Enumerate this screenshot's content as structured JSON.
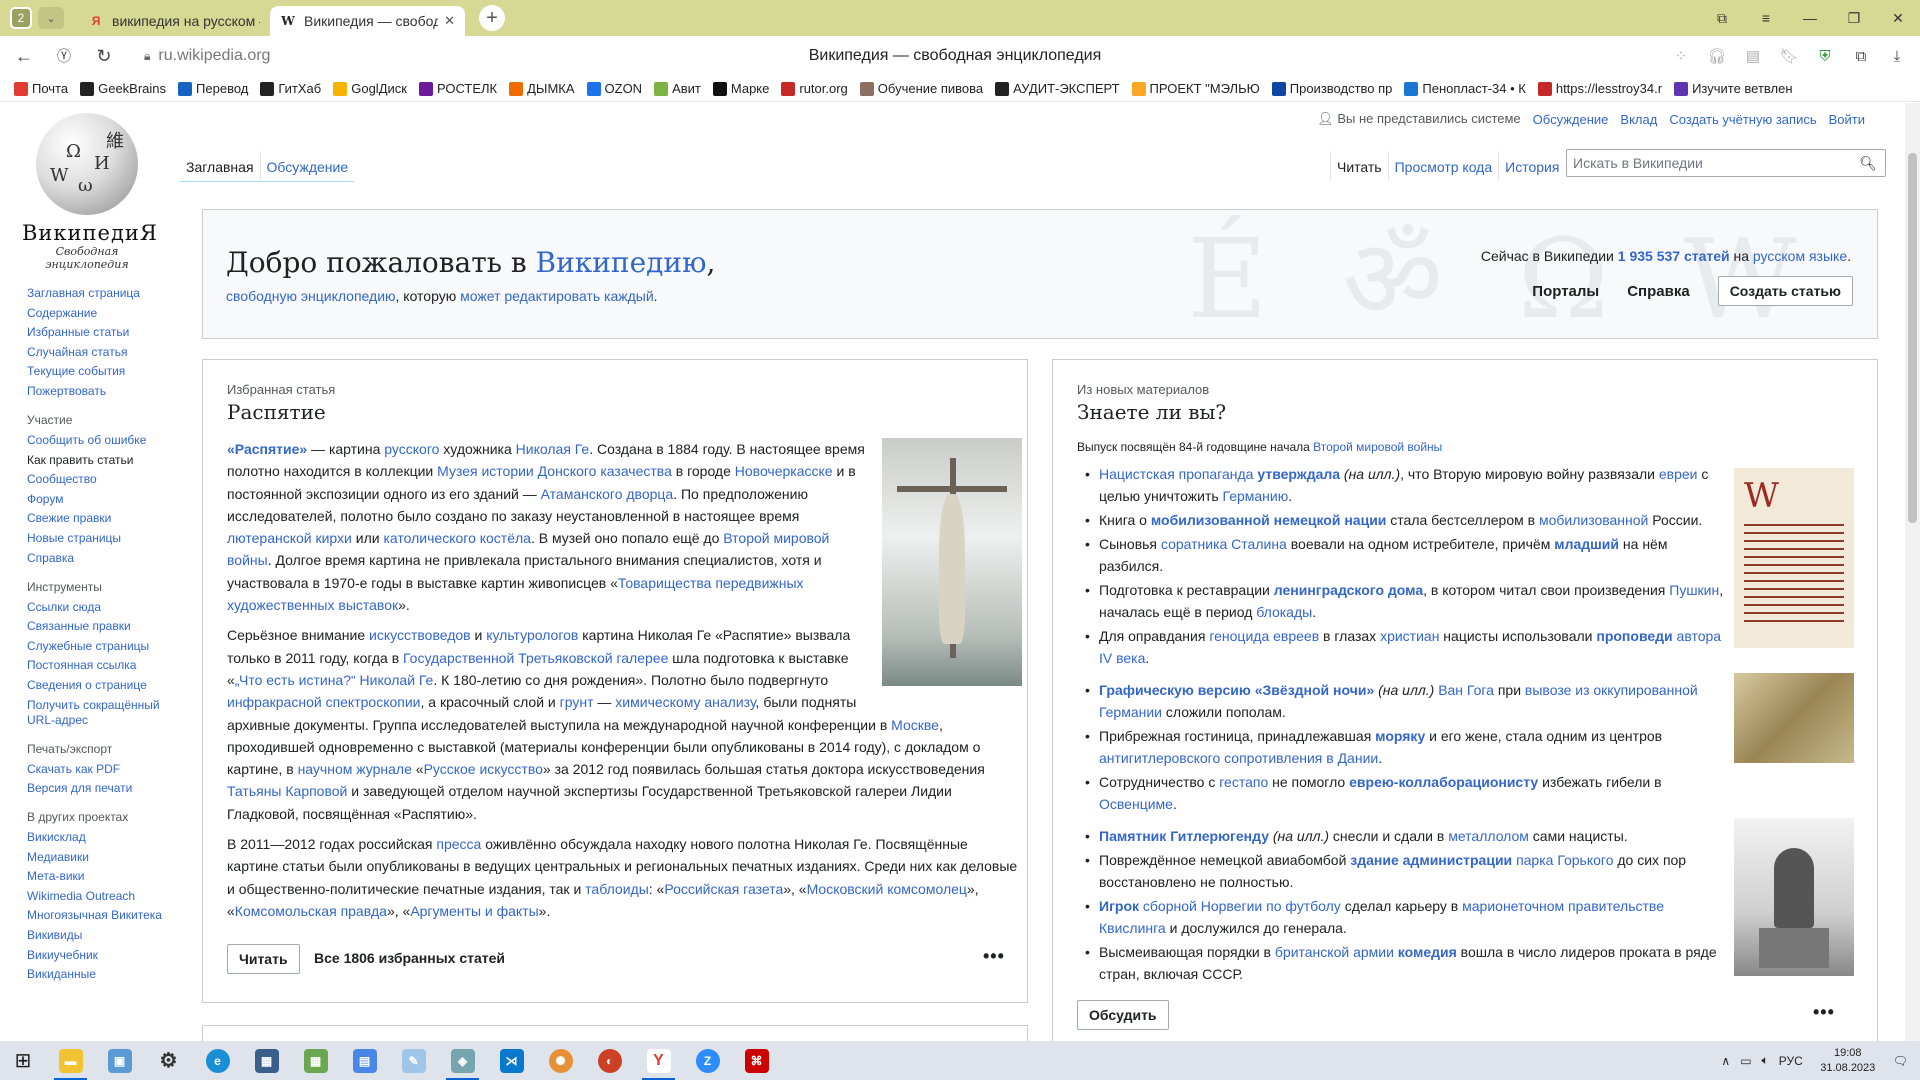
{
  "browser": {
    "tab_counter": "2",
    "tabs": [
      {
        "favicon": "Я",
        "title": "википедия на русском —"
      },
      {
        "favicon": "W",
        "title": "Википедия — свободна"
      }
    ],
    "url": "ru.wikipedia.org",
    "page_title": "Википедия — свободная энциклопедия",
    "bookmarks": [
      "Почта",
      "GeekBrains",
      "Перевод",
      "ГитХаб",
      "GoglДиск",
      "РОСТЕЛК",
      "ДЫМКА",
      "OZON",
      "Авит",
      "Марке",
      "rutor.org",
      "Обучение пивова",
      "АУДИТ-ЭКСПЕРТ",
      "ПРОЕКТ \"МЭЛЬЮ",
      "Производство пр",
      "Пенопласт-34 • К",
      "https://lesstroy34.r",
      "Изучите ветвлен"
    ]
  },
  "wiki": {
    "wordmark": "ВикипедиЯ",
    "tagline": "Свободная энциклопедия",
    "sidebar_main": [
      "Заглавная страница",
      "Содержание",
      "Избранные статьи",
      "Случайная статья",
      "Текущие события",
      "Пожертвовать"
    ],
    "participation_head": "Участие",
    "participation": [
      "Сообщить об ошибке",
      "Как править статьи",
      "Сообщество",
      "Форум",
      "Свежие правки",
      "Новые страницы",
      "Справка"
    ],
    "tools_head": "Инструменты",
    "tools": [
      "Ссылки сюда",
      "Связанные правки",
      "Служебные страницы",
      "Постоянная ссылка",
      "Сведения о странице",
      "Получить сокращённый URL-адрес"
    ],
    "print_head": "Печать/экспорт",
    "print": [
      "Скачать как PDF",
      "Версия для печати"
    ],
    "projects_head": "В других проектах",
    "projects": [
      "Викисклад",
      "Медиавики",
      "Мета-вики",
      "Wikimedia Outreach",
      "Многоязычная Викитека",
      "Викивиды",
      "Викиучебник",
      "Викиданные"
    ],
    "user": {
      "not_logged": "Вы не представились системе",
      "talk": "Обсуждение",
      "contrib": "Вклад",
      "create": "Создать учётную запись",
      "login": "Войти"
    },
    "tabs_left": [
      "Заглавная",
      "Обсуждение"
    ],
    "tabs_right": [
      "Читать",
      "Просмотр кода",
      "История"
    ],
    "search_placeholder": "Искать в Википедии",
    "welcome": {
      "h_prefix": "Добро пожаловать в ",
      "h_link": "Википедию",
      "h_suffix": ",",
      "sub_link1": "свободную энциклопедию",
      "sub_mid": ", которую ",
      "sub_link2": "может редактировать каждый",
      "sub_end": ".",
      "count_pre": "Сейчас в Википедии ",
      "count": "1 935 537 статей",
      "count_mid": " на ",
      "count_link": "русском языке",
      "count_end": ".",
      "portals": "Порталы",
      "help": "Справка",
      "create": "Создать статью"
    },
    "featured": {
      "label": "Избранная статья",
      "title": "Распятие",
      "read": "Читать",
      "all": "Все 1806 избранных статей",
      "more": "•••",
      "p1": [
        [
          "b",
          "«Распятие»"
        ],
        [
          "t",
          " — картина "
        ],
        [
          "a",
          "русского"
        ],
        [
          "t",
          " художника "
        ],
        [
          "a",
          "Николая Ге"
        ],
        [
          "t",
          ". Создана в 1884 году. В настоящее время полотно находится в коллекции "
        ],
        [
          "a",
          "Музея истории Донского казачества"
        ],
        [
          "t",
          " в городе "
        ],
        [
          "a",
          "Новочеркасске"
        ],
        [
          "t",
          " и в постоянной экспозиции одного из его зданий — "
        ],
        [
          "a",
          "Атаманского дворца"
        ],
        [
          "t",
          ". По предположению исследователей, полотно было создано по заказу неустановленной в настоящее время "
        ],
        [
          "a",
          "лютеранской кирхи"
        ],
        [
          "t",
          " или "
        ],
        [
          "a",
          "католического костёла"
        ],
        [
          "t",
          ". В музей оно попало ещё до "
        ],
        [
          "a",
          "Второй мировой войны"
        ],
        [
          "t",
          ". Долгое время картина не привлекала пристального внимания специалистов, хотя и участвовала в 1970-е годы в выставке картин живописцев «"
        ],
        [
          "a",
          "Товарищества передвижных художественных выставок"
        ],
        [
          "t",
          "»."
        ]
      ],
      "p2": [
        [
          "t",
          "Серьёзное внимание "
        ],
        [
          "a",
          "искусствоведов"
        ],
        [
          "t",
          " и "
        ],
        [
          "a",
          "культурологов"
        ],
        [
          "t",
          " картина Николая Ге «Распятие» вызвала только в 2011 году, когда в "
        ],
        [
          "a",
          "Государственной Третьяковской галерее"
        ],
        [
          "t",
          " шла подготовка к выставке «"
        ],
        [
          "a",
          "„Что есть истина?“ Николай Ге"
        ],
        [
          "t",
          ". К 180-летию со дня рождения». Полотно было подвергнуто "
        ],
        [
          "a",
          "инфракрасной спектроскопии"
        ],
        [
          "t",
          ", а красочный слой и "
        ],
        [
          "a",
          "грунт"
        ],
        [
          "t",
          " — "
        ],
        [
          "a",
          "химическому анализу"
        ],
        [
          "t",
          ", были подняты архивные документы. Группа исследователей выступила на международной научной конференции в "
        ],
        [
          "a",
          "Москве"
        ],
        [
          "t",
          ", проходившей одновременно с выставкой (материалы конференции были опубликованы в 2014 году), с докладом о картине, в "
        ],
        [
          "a",
          "научном журнале"
        ],
        [
          "t",
          " «"
        ],
        [
          "a",
          "Русское искусство"
        ],
        [
          "t",
          "» за 2012 год появилась большая статья доктора искусствоведения "
        ],
        [
          "a",
          "Татьяны Карповой"
        ],
        [
          "t",
          " и заведующей отделом научной экспертизы Государственной Третьяковской галереи Лидии Гладковой, посвящённая «Распятию»."
        ]
      ],
      "p3": [
        [
          "t",
          "В 2011—2012 годах российская "
        ],
        [
          "a",
          "пресса"
        ],
        [
          "t",
          " оживлённо обсуждала находку нового полотна Николая Ге. Посвящённые картине статьи были опубликованы в ведущих центральных и региональных печатных изданиях. Среди них как деловые и общественно-политические печатные издания, так и "
        ],
        [
          "a",
          "таблоиды"
        ],
        [
          "t",
          ": «"
        ],
        [
          "a",
          "Российская газета"
        ],
        [
          "t",
          "», «"
        ],
        [
          "a",
          "Московский комсомолец"
        ],
        [
          "t",
          "», «"
        ],
        [
          "a",
          "Комсомольская правда"
        ],
        [
          "t",
          "», «"
        ],
        [
          "a",
          "Аргументы и факты"
        ],
        [
          "t",
          "»."
        ]
      ]
    },
    "dyk": {
      "label": "Из новых материалов",
      "title": "Знаете ли вы?",
      "sub_pre": "Выпуск посвящён 84-й годовщине начала ",
      "sub_link": "Второй мировой войны",
      "discuss": "Обсудить",
      "more": "•••",
      "items": [
        [
          [
            "a",
            "Нацистская пропаганда"
          ],
          [
            "t",
            " "
          ],
          [
            "ab",
            "утверждала"
          ],
          [
            "i",
            " (на илл.)"
          ],
          [
            "t",
            ", что Вторую мировую войну развязали "
          ],
          [
            "a",
            "евреи"
          ],
          [
            "t",
            " с целью уничтожить "
          ],
          [
            "a",
            "Германию"
          ],
          [
            "t",
            "."
          ]
        ],
        [
          [
            "t",
            "Книга о "
          ],
          [
            "ab",
            "мобилизованной немецкой нации"
          ],
          [
            "t",
            " стала бестселлером в "
          ],
          [
            "a",
            "мобилизованной"
          ],
          [
            "t",
            " России."
          ]
        ],
        [
          [
            "t",
            "Сыновья "
          ],
          [
            "a",
            "соратника Сталина"
          ],
          [
            "t",
            " воевали на одном истребителе, причём "
          ],
          [
            "ab",
            "младший"
          ],
          [
            "t",
            " на нём разбился."
          ]
        ],
        [
          [
            "t",
            "Подготовка к реставрации "
          ],
          [
            "ab",
            "ленинградского дома"
          ],
          [
            "t",
            ", в котором читал свои произведения "
          ],
          [
            "a",
            "Пушкин"
          ],
          [
            "t",
            ", началась ещё в период "
          ],
          [
            "a",
            "блокады"
          ],
          [
            "t",
            "."
          ]
        ],
        [
          [
            "t",
            "Для оправдания "
          ],
          [
            "a",
            "геноцида евреев"
          ],
          [
            "t",
            " в глазах "
          ],
          [
            "a",
            "христиан"
          ],
          [
            "t",
            " нацисты использовали "
          ],
          [
            "ab",
            "проповеди"
          ],
          [
            "t",
            " "
          ],
          [
            "a",
            "автора IV века"
          ],
          [
            "t",
            "."
          ]
        ],
        [
          [
            "ab",
            "Графическую версию «Звёздной ночи»"
          ],
          [
            "i",
            " (на илл.)"
          ],
          [
            "t",
            " "
          ],
          [
            "a",
            "Ван Гога"
          ],
          [
            "t",
            " при "
          ],
          [
            "a",
            "вывозе из оккупированной Германии"
          ],
          [
            "t",
            " сложили пополам."
          ]
        ],
        [
          [
            "t",
            "Прибрежная гостиница, принадлежавшая "
          ],
          [
            "ab",
            "моряку"
          ],
          [
            "t",
            " и его жене, стала одним из центров "
          ],
          [
            "a",
            "антигитлеровского сопротивления в Дании"
          ],
          [
            "t",
            "."
          ]
        ],
        [
          [
            "t",
            "Сотрудничество с "
          ],
          [
            "a",
            "гестапо"
          ],
          [
            "t",
            " не помогло "
          ],
          [
            "ab",
            "еврею-коллаборационисту"
          ],
          [
            "t",
            " избежать гибели в "
          ],
          [
            "a",
            "Освенциме"
          ],
          [
            "t",
            "."
          ]
        ],
        [
          [
            "ab",
            "Памятник Гитлерюгенду"
          ],
          [
            "i",
            " (на илл.)"
          ],
          [
            "t",
            " снесли и сдали в "
          ],
          [
            "a",
            "металлолом"
          ],
          [
            "t",
            " сами нацисты."
          ]
        ],
        [
          [
            "t",
            "Повреждённое немецкой авиабомбой "
          ],
          [
            "ab",
            "здание администрации"
          ],
          [
            "t",
            " "
          ],
          [
            "a",
            "парка Горького"
          ],
          [
            "t",
            " до сих пор восстановлено не полностью."
          ]
        ],
        [
          [
            "ab",
            "Игрок"
          ],
          [
            "t",
            " "
          ],
          [
            "a",
            "сборной Норвегии по футболу"
          ],
          [
            "t",
            " сделал карьеру в "
          ],
          [
            "a",
            "марионеточном правительстве Квислинга"
          ],
          [
            "t",
            " и дослужился до генерала."
          ]
        ],
        [
          [
            "t",
            "Высмеивающая порядки в "
          ],
          [
            "a",
            "британской армии"
          ],
          [
            "t",
            " "
          ],
          [
            "ab",
            "комедия"
          ],
          [
            "t",
            " вошла в число лидеров проката в ряде стран, включая СССР."
          ]
        ]
      ]
    }
  },
  "taskbar": {
    "lang": "РУС",
    "time": "19:08",
    "date": "31.08.2023"
  },
  "colors": {
    "link": "#3366cc",
    "tabbar": "#d6d993",
    "taskbar": "#dfe4ec"
  }
}
